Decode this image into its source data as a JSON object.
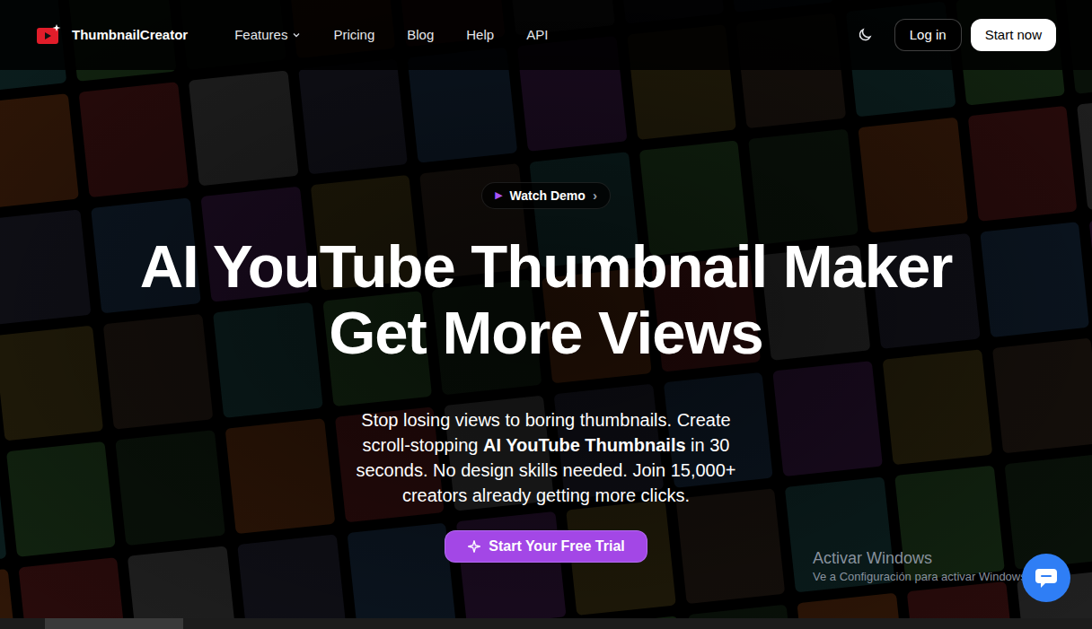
{
  "header": {
    "logo": "ThumbnailCreator",
    "nav": [
      {
        "label": "Features",
        "has_dropdown": true
      },
      {
        "label": "Pricing",
        "has_dropdown": false
      },
      {
        "label": "Blog",
        "has_dropdown": false
      },
      {
        "label": "Help",
        "has_dropdown": false
      },
      {
        "label": "API",
        "has_dropdown": false
      }
    ],
    "login": "Log in",
    "start": "Start now"
  },
  "hero": {
    "demo_icon": "▶",
    "demo": "Watch Demo",
    "demo_chevron": "›",
    "title_lines": [
      "AI YouTube Thumbnail Maker",
      "Get More Views"
    ],
    "subtitle": {
      "before": "Stop losing views to boring thumbnails. Create scroll-stopping ",
      "bold": "AI YouTube Thumbnails",
      "after": " in 30 seconds. No design skills needed. Join 15,000+ creators already getting more clicks."
    },
    "cta": "Start Your Free Trial"
  },
  "windows_watermark": {
    "title": "Activar Windows",
    "subtitle": "Ve a Configuración para activar Windows"
  }
}
